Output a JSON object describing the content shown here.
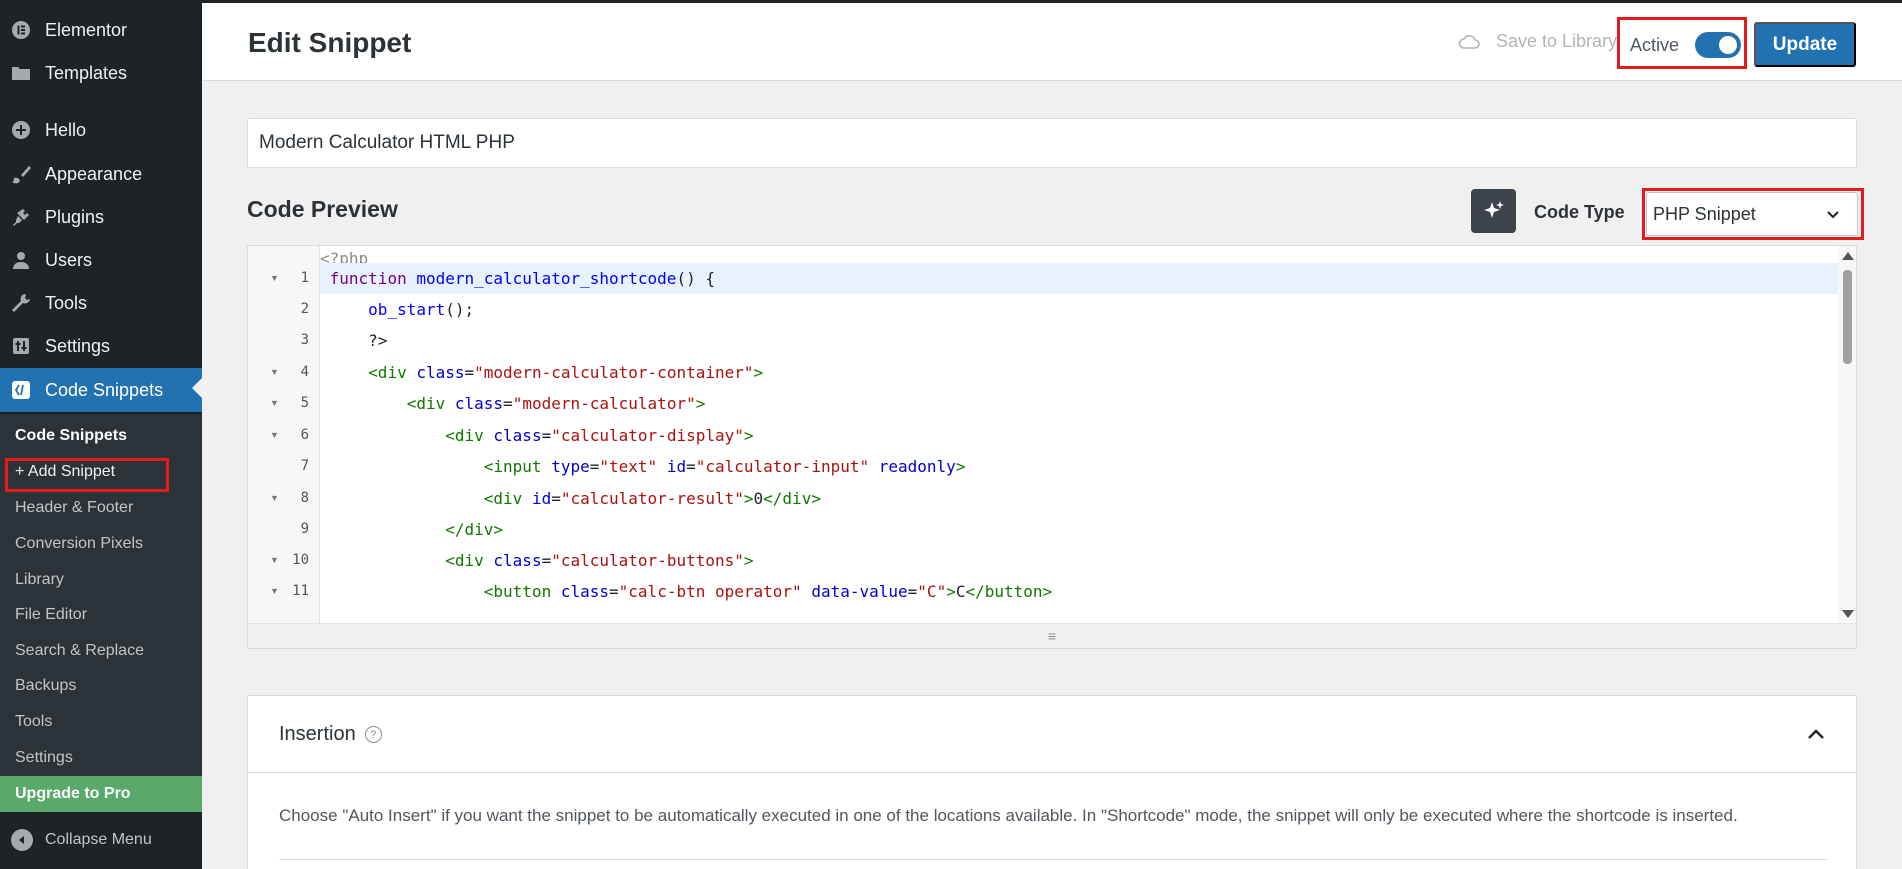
{
  "sidebar": {
    "items": [
      {
        "label": "Elementor",
        "icon": "elementor-icon"
      },
      {
        "label": "Templates",
        "icon": "folder-icon"
      },
      {
        "label": "Hello",
        "icon": "plus-circle-icon"
      },
      {
        "label": "Appearance",
        "icon": "brush-icon"
      },
      {
        "label": "Plugins",
        "icon": "plug-icon"
      },
      {
        "label": "Users",
        "icon": "user-icon"
      },
      {
        "label": "Tools",
        "icon": "wrench-icon"
      },
      {
        "label": "Settings",
        "icon": "sliders-icon"
      },
      {
        "label": "Code Snippets",
        "icon": "code-snippets-icon"
      }
    ],
    "submenu": [
      "Code Snippets",
      "+ Add Snippet",
      "Header & Footer",
      "Conversion Pixels",
      "Library",
      "File Editor",
      "Search & Replace",
      "Backups",
      "Tools",
      "Settings"
    ],
    "upgrade": "Upgrade to Pro",
    "collapse": "Collapse Menu"
  },
  "header": {
    "title": "Edit Snippet",
    "save_to_library": "Save to Library",
    "active_label": "Active",
    "active": true,
    "update": "Update"
  },
  "snippet": {
    "title": "Modern Calculator HTML PHP"
  },
  "code_preview": {
    "title": "Code Preview",
    "code_type_label": "Code Type",
    "code_type": "PHP Snippet",
    "prefix": "<?php",
    "line_numbers": [
      "1",
      "2",
      "3",
      "4",
      "5",
      "6",
      "7",
      "8",
      "9",
      "10",
      "11"
    ]
  },
  "insertion": {
    "title": "Insertion",
    "description": "Choose \"Auto Insert\" if you want the snippet to be automatically executed in one of the locations available. In \"Shortcode\" mode, the snippet will only be executed where the shortcode is inserted."
  },
  "colors": {
    "accent": "#2271b1",
    "sidebar_bg": "#1d2327",
    "upgrade": "#59a96a",
    "highlight_box": "#e51b1b"
  }
}
